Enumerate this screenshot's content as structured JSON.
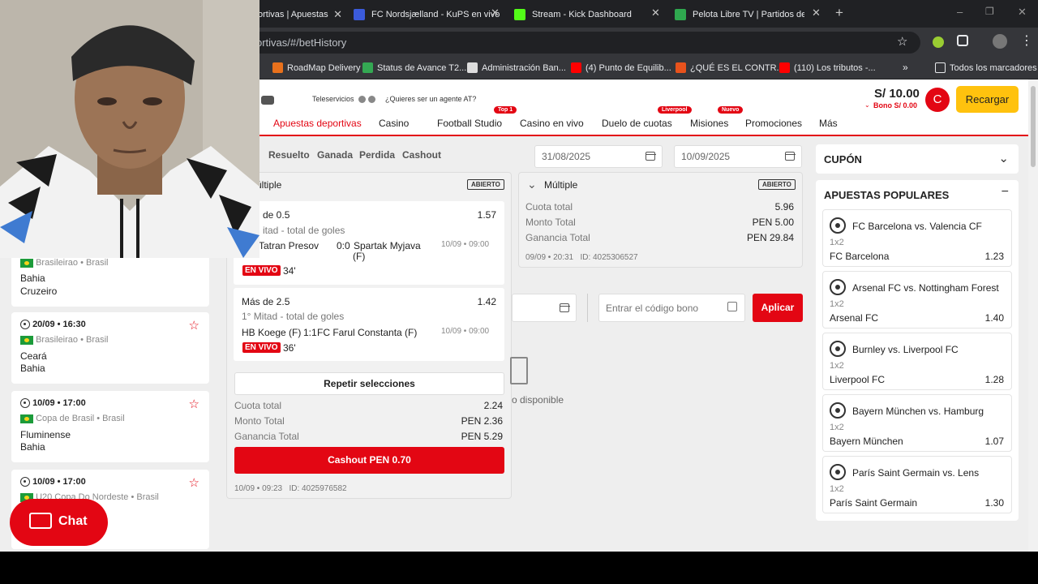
{
  "browser": {
    "tabs": [
      {
        "title": "ortivas | Apuestas"
      },
      {
        "title": "FC Nordsjælland - KuPS en vivo"
      },
      {
        "title": "Stream - Kick Dashboard"
      },
      {
        "title": "Pelota Libre TV | Partidos de Fú"
      }
    ],
    "address": "ortivas/#/betHistory",
    "bookmarks": [
      "RoadMap Delivery",
      "Status de Avance T2...",
      "Administración Ban...",
      "(4) Punto de Equilib...",
      "¿QUÉ ES EL CONTR...",
      "(110) Los tributos -...",
      "Todos los marcadores"
    ]
  },
  "header": {
    "teleservicios": "Teleservicios",
    "agent": "¿Quieres ser un agente AT?",
    "balance": "S/ 10.00",
    "bono": "Bono S/ 0.00",
    "avatar": "C",
    "recargar": "Recargar",
    "nav": [
      {
        "label": "Apuestas deportivas",
        "badge": ""
      },
      {
        "label": "Casino",
        "badge": ""
      },
      {
        "label": "Football Studio",
        "badge": "Top 1"
      },
      {
        "label": "Casino en vivo",
        "badge": ""
      },
      {
        "label": "Duelo de cuotas",
        "badge": "Liverpool"
      },
      {
        "label": "Misiones",
        "badge": "Nuevo"
      },
      {
        "label": "Promociones",
        "badge": ""
      },
      {
        "label": "Más",
        "badge": ""
      }
    ]
  },
  "filters": [
    "Resuelto",
    "Ganada",
    "Perdida",
    "Cashout"
  ],
  "dates": {
    "from": "31/08/2025",
    "to": "10/09/2025"
  },
  "left_matches": [
    {
      "time": "",
      "league": "Brasileirao • Brasil",
      "home": "Bahia",
      "away": "Cruzeiro"
    },
    {
      "time": "20/09 • 16:30",
      "league": "Brasileirao • Brasil",
      "home": "Ceará",
      "away": "Bahia"
    },
    {
      "time": "10/09 • 17:00",
      "league": "Copa de Brasil • Brasil",
      "home": "Fluminense",
      "away": "Bahia"
    },
    {
      "time": "10/09 • 17:00",
      "league": "U20 Copa Do Nordeste • Brasil",
      "home": "",
      "away": ""
    }
  ],
  "chat": "Chat",
  "bet1": {
    "title": "últiple",
    "status": "ABIERTO",
    "selections": [
      {
        "market": "de 0.5",
        "odd": "1.57",
        "sub": "itad - total de goles",
        "home": "Tatran Presov",
        "score": "0:0",
        "away": "Spartak Myjava",
        "away2": "(F)",
        "date": "10/09 • 09:00",
        "live": "EN VIVO",
        "minute": "34'"
      },
      {
        "market": "Más de 2.5",
        "odd": "1.42",
        "sub": "1° Mitad - total de goles",
        "home": "HB Koege (F)",
        "score": "1:1",
        "away": "FC Farul Constanta (F)",
        "away2": "",
        "date": "10/09 • 09:00",
        "live": "EN VIVO",
        "minute": "36'"
      }
    ],
    "repeat": "Repetir selecciones",
    "cuota_label": "Cuota total",
    "cuota": "2.24",
    "monto_label": "Monto Total",
    "monto": "PEN 2.36",
    "ganancia_label": "Ganancia Total",
    "ganancia": "PEN 5.29",
    "cashout": "Cashout PEN 0.70",
    "footer": "10/09 • 09:23   ID: 4025976582"
  },
  "bet2": {
    "title": "Múltiple",
    "status": "ABIERTO",
    "cuota_label": "Cuota total",
    "cuota": "5.96",
    "monto_label": "Monto Total",
    "monto": "PEN 5.00",
    "ganancia_label": "Ganancia Total",
    "ganancia": "PEN 29.84",
    "footer": "09/09 • 20:31   ID: 4025306527"
  },
  "bono_code": {
    "placeholder": "Entrar el código bono",
    "apply": "Aplicar",
    "empty": "o disponible"
  },
  "coupon": {
    "title": "CUPÓN"
  },
  "popular": {
    "title": "APUESTAS POPULARES",
    "items": [
      {
        "match": "FC Barcelona vs. Valencia CF",
        "type": "1x2",
        "pick": "FC Barcelona",
        "odd": "1.23"
      },
      {
        "match": "Arsenal FC vs. Nottingham Forest",
        "type": "1x2",
        "pick": "Arsenal FC",
        "odd": "1.40"
      },
      {
        "match": "Burnley vs. Liverpool FC",
        "type": "1x2",
        "pick": "Liverpool FC",
        "odd": "1.28"
      },
      {
        "match": "Bayern München vs. Hamburg",
        "type": "1x2",
        "pick": "Bayern München",
        "odd": "1.07"
      },
      {
        "match": "París Saint Germain vs. Lens",
        "type": "1x2",
        "pick": "París Saint Germain",
        "odd": "1.30"
      }
    ]
  }
}
